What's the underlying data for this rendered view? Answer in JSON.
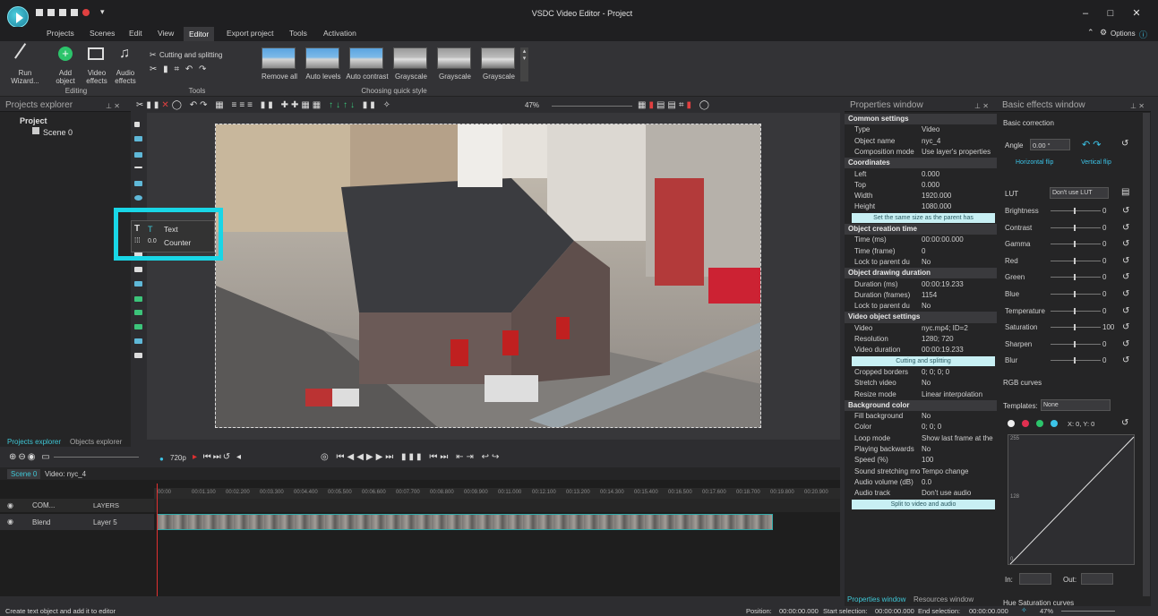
{
  "window": {
    "title": "VSDC Video Editor - Project",
    "options_label": "Options"
  },
  "menu": [
    "Projects",
    "Scenes",
    "Edit",
    "View",
    "Editor",
    "Export project",
    "Tools",
    "Activation"
  ],
  "ribbon": {
    "run_wizard": "Run Wizard...",
    "add_object": "Add object",
    "video_effects": "Video effects",
    "audio_effects": "Audio effects",
    "editing_group": "Editing",
    "cutting": "Cutting and splitting",
    "tools_group": "Tools",
    "quick_styles": [
      "Remove all",
      "Auto levels",
      "Auto contrast",
      "Grayscale",
      "Grayscale",
      "Grayscale"
    ],
    "quick_group": "Choosing quick style"
  },
  "projects_explorer": {
    "title": "Projects explorer",
    "project": "Project",
    "scene": "Scene 0",
    "tab1": "Projects explorer",
    "tab2": "Objects explorer"
  },
  "popup": {
    "text": "Text",
    "counter": "Counter"
  },
  "zoom": "47%",
  "props": {
    "title": "Properties window",
    "common": "Common settings",
    "rows1": [
      {
        "k": "Type",
        "v": "Video"
      },
      {
        "k": "Object name",
        "v": "nyc_4"
      },
      {
        "k": "Composition mode",
        "v": "Use layer's properties"
      }
    ],
    "coordinates": "Coordinates",
    "rows2": [
      {
        "k": "Left",
        "v": "0.000"
      },
      {
        "k": "Top",
        "v": "0.000"
      },
      {
        "k": "Width",
        "v": "1920.000"
      },
      {
        "k": "Height",
        "v": "1080.000"
      }
    ],
    "same_size": "Set the same size as the parent has",
    "creation": "Object creation time",
    "rows3": [
      {
        "k": "Time (ms)",
        "v": "00:00:00.000"
      },
      {
        "k": "Time (frame)",
        "v": "0"
      },
      {
        "k": "Lock to parent du",
        "v": "No"
      }
    ],
    "drawing": "Object drawing duration",
    "rows4": [
      {
        "k": "Duration (ms)",
        "v": "00:00:19.233"
      },
      {
        "k": "Duration (frames)",
        "v": "1154"
      },
      {
        "k": "Lock to parent du",
        "v": "No"
      }
    ],
    "video_settings": "Video object settings",
    "rows5": [
      {
        "k": "Video",
        "v": "nyc.mp4; ID=2"
      },
      {
        "k": "Resolution",
        "v": "1280; 720"
      },
      {
        "k": "Video duration",
        "v": "00:00:19.233"
      }
    ],
    "cutting_btn": "Cutting and splitting",
    "rows6": [
      {
        "k": "Cropped borders",
        "v": "0; 0; 0; 0"
      },
      {
        "k": "Stretch video",
        "v": "No"
      },
      {
        "k": "Resize mode",
        "v": "Linear interpolation"
      }
    ],
    "bg_color": "Background color",
    "rows7": [
      {
        "k": "Fill background",
        "v": "No"
      },
      {
        "k": "Color",
        "v": "0; 0; 0"
      }
    ],
    "rows8": [
      {
        "k": "Loop mode",
        "v": "Show last frame at the"
      },
      {
        "k": "Playing backwards",
        "v": "No"
      },
      {
        "k": "Speed (%)",
        "v": "100"
      },
      {
        "k": "Sound stretching mo",
        "v": "Tempo change"
      },
      {
        "k": "Audio volume (dB)",
        "v": "0.0"
      },
      {
        "k": "Audio track",
        "v": "Don't use audio"
      }
    ],
    "split_btn": "Split to video and audio",
    "tab1": "Properties window",
    "tab2": "Resources window"
  },
  "effects": {
    "title": "Basic effects window",
    "basic": "Basic correction",
    "angle_label": "Angle",
    "angle_value": "0.00 °",
    "hflip": "Horizontal flip",
    "vflip": "Vertical flip",
    "lut_label": "LUT",
    "lut_value": "Don't use LUT",
    "rows": [
      {
        "k": "Brightness",
        "v": "0"
      },
      {
        "k": "Contrast",
        "v": "0"
      },
      {
        "k": "Gamma",
        "v": "0"
      },
      {
        "k": "Red",
        "v": "0"
      },
      {
        "k": "Green",
        "v": "0"
      },
      {
        "k": "Blue",
        "v": "0"
      },
      {
        "k": "Temperature",
        "v": "0"
      },
      {
        "k": "Saturation",
        "v": "100"
      },
      {
        "k": "Sharpen",
        "v": "0"
      },
      {
        "k": "Blur",
        "v": "0"
      }
    ],
    "rgb": "RGB curves",
    "templates_label": "Templates:",
    "templates_value": "None",
    "xy": "X: 0, Y: 0",
    "curve_top": "255",
    "curve_mid": "128",
    "curve_bottom": "0",
    "in_label": "In:",
    "out_label": "Out:",
    "hue": "Hue Saturation curves"
  },
  "timeline": {
    "resolution": "720p",
    "tab_scene": "Scene 0",
    "tab_video": "Video: nyc_4",
    "com": "COM...",
    "layers": "LAYERS",
    "blend": "Blend",
    "layer": "Layer 5",
    "ticks": [
      "00:00",
      "00:01.100",
      "00:02.200",
      "00:03.300",
      "00:04.400",
      "00:05.500",
      "00:06.600",
      "00:07.700",
      "00:08.800",
      "00:09.900",
      "00:11.000",
      "00:12.100",
      "00:13.200",
      "00:14.300",
      "00:15.400",
      "00:16.500",
      "00:17.600",
      "00:18.700",
      "00:19.800",
      "00:20.900"
    ]
  },
  "status": {
    "hint": "Create text object and add it to editor",
    "position_label": "Position:",
    "position": "00:00:00.000",
    "start_label": "Start selection:",
    "start": "00:00:00.000",
    "end_label": "End selection:",
    "end": "00:00:00.000",
    "zoom": "47%"
  }
}
